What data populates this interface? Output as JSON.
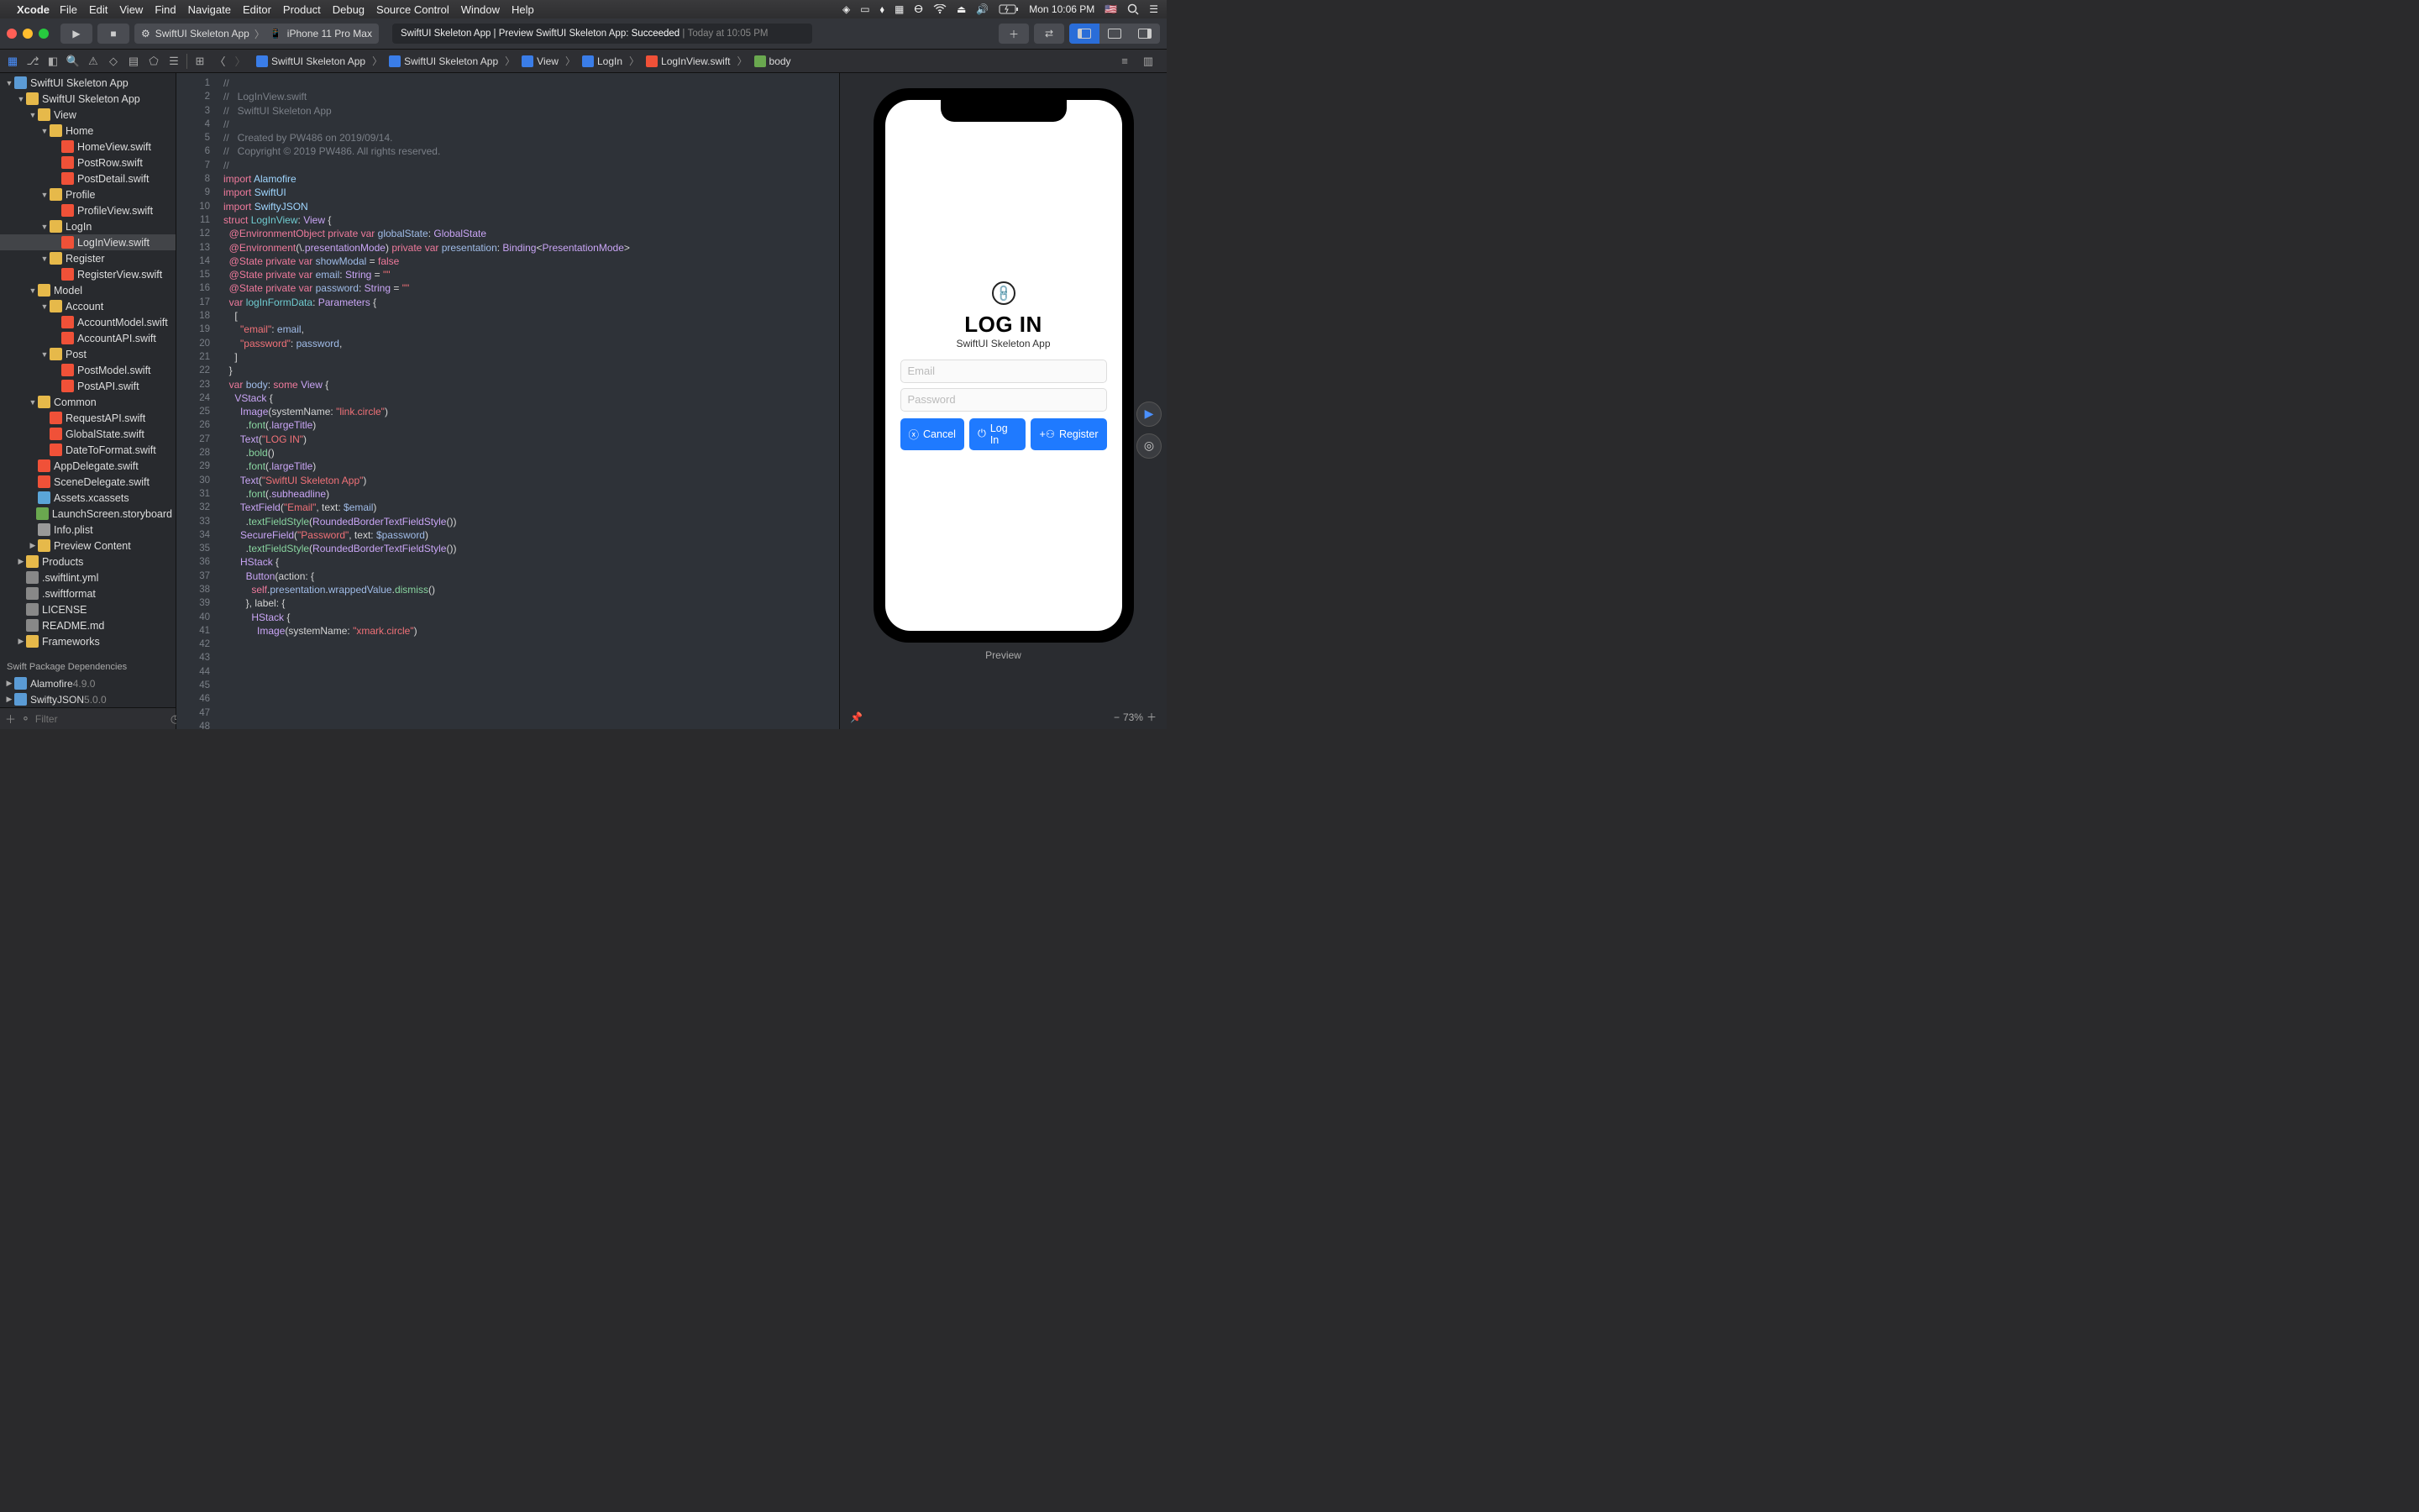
{
  "menubar": {
    "app": "Xcode",
    "items": [
      "File",
      "Edit",
      "View",
      "Find",
      "Navigate",
      "Editor",
      "Product",
      "Debug",
      "Source Control",
      "Window",
      "Help"
    ],
    "time": "Mon 10:06 PM"
  },
  "toolbar": {
    "scheme_app": "SwiftUI Skeleton App",
    "scheme_device": "iPhone 11 Pro Max",
    "activity_target": "SwiftUI Skeleton App | Preview SwiftUI Skeleton App:",
    "activity_status": "Succeeded",
    "activity_time": "Today at 10:05 PM"
  },
  "jumpbar": [
    "SwiftUI Skeleton App",
    "SwiftUI Skeleton App",
    "View",
    "LogIn",
    "LogInView.swift",
    "body"
  ],
  "tree": [
    {
      "d": 0,
      "t": "SwiftUI Skeleton App",
      "i": "proj",
      "e": true
    },
    {
      "d": 1,
      "t": "SwiftUI Skeleton App",
      "i": "folder",
      "e": true,
      "y": true
    },
    {
      "d": 2,
      "t": "View",
      "i": "folder",
      "e": true,
      "y": true
    },
    {
      "d": 3,
      "t": "Home",
      "i": "folder",
      "e": true,
      "y": true
    },
    {
      "d": 4,
      "t": "HomeView.swift",
      "i": "swift"
    },
    {
      "d": 4,
      "t": "PostRow.swift",
      "i": "swift"
    },
    {
      "d": 4,
      "t": "PostDetail.swift",
      "i": "swift"
    },
    {
      "d": 3,
      "t": "Profile",
      "i": "folder",
      "e": true,
      "y": true
    },
    {
      "d": 4,
      "t": "ProfileView.swift",
      "i": "swift"
    },
    {
      "d": 3,
      "t": "LogIn",
      "i": "folder",
      "e": true,
      "y": true
    },
    {
      "d": 4,
      "t": "LogInView.swift",
      "i": "swift",
      "sel": true
    },
    {
      "d": 3,
      "t": "Register",
      "i": "folder",
      "e": true,
      "y": true
    },
    {
      "d": 4,
      "t": "RegisterView.swift",
      "i": "swift"
    },
    {
      "d": 2,
      "t": "Model",
      "i": "folder",
      "e": true,
      "y": true
    },
    {
      "d": 3,
      "t": "Account",
      "i": "folder",
      "e": true,
      "y": true
    },
    {
      "d": 4,
      "t": "AccountModel.swift",
      "i": "swift"
    },
    {
      "d": 4,
      "t": "AccountAPI.swift",
      "i": "swift"
    },
    {
      "d": 3,
      "t": "Post",
      "i": "folder",
      "e": true,
      "y": true
    },
    {
      "d": 4,
      "t": "PostModel.swift",
      "i": "swift"
    },
    {
      "d": 4,
      "t": "PostAPI.swift",
      "i": "swift"
    },
    {
      "d": 2,
      "t": "Common",
      "i": "folder",
      "e": true,
      "y": true
    },
    {
      "d": 3,
      "t": "RequestAPI.swift",
      "i": "swift"
    },
    {
      "d": 3,
      "t": "GlobalState.swift",
      "i": "swift"
    },
    {
      "d": 3,
      "t": "DateToFormat.swift",
      "i": "swift"
    },
    {
      "d": 2,
      "t": "AppDelegate.swift",
      "i": "swift"
    },
    {
      "d": 2,
      "t": "SceneDelegate.swift",
      "i": "swift"
    },
    {
      "d": 2,
      "t": "Assets.xcassets",
      "i": "img"
    },
    {
      "d": 2,
      "t": "LaunchScreen.storyboard",
      "i": "storyboard"
    },
    {
      "d": 2,
      "t": "Info.plist",
      "i": "plist"
    },
    {
      "d": 2,
      "t": "Preview Content",
      "i": "folder",
      "e": false,
      "y": true
    },
    {
      "d": 1,
      "t": "Products",
      "i": "folder",
      "e": false,
      "y": true
    },
    {
      "d": 1,
      "t": ".swiftlint.yml",
      "i": "file"
    },
    {
      "d": 1,
      "t": ".swiftformat",
      "i": "file"
    },
    {
      "d": 1,
      "t": "LICENSE",
      "i": "file"
    },
    {
      "d": 1,
      "t": "README.md",
      "i": "file"
    },
    {
      "d": 1,
      "t": "Frameworks",
      "i": "folder",
      "e": false,
      "y": true
    }
  ],
  "deps_header": "Swift Package Dependencies",
  "deps": [
    {
      "name": "Alamofire",
      "ver": "4.9.0"
    },
    {
      "name": "SwiftyJSON",
      "ver": "5.0.0"
    }
  ],
  "filter_placeholder": "Filter",
  "code_lines": [
    [
      [
        "c-comment",
        "//"
      ]
    ],
    [
      [
        "c-comment",
        "//   LogInView.swift"
      ]
    ],
    [
      [
        "c-comment",
        "//   SwiftUI Skeleton App"
      ]
    ],
    [
      [
        "c-comment",
        "//"
      ]
    ],
    [
      [
        "c-comment",
        "//   Created by PW486 on 2019/09/14."
      ]
    ],
    [
      [
        "c-comment",
        "//   Copyright © 2019 PW486. All rights reserved."
      ]
    ],
    [
      [
        "c-comment",
        "//"
      ]
    ],
    [
      [
        "",
        ""
      ]
    ],
    [
      [
        "c-keyword",
        "import"
      ],
      [
        "",
        " "
      ],
      [
        "c-type",
        "Alamofire"
      ]
    ],
    [
      [
        "c-keyword",
        "import"
      ],
      [
        "",
        " "
      ],
      [
        "c-type",
        "SwiftUI"
      ]
    ],
    [
      [
        "c-keyword",
        "import"
      ],
      [
        "",
        " "
      ],
      [
        "c-type",
        "SwiftyJSON"
      ]
    ],
    [
      [
        "",
        ""
      ]
    ],
    [
      [
        "c-keyword",
        "struct"
      ],
      [
        "",
        " "
      ],
      [
        "c-teal",
        "LogInView"
      ],
      [
        "",
        ": "
      ],
      [
        "c-purple",
        "View"
      ],
      [
        "",
        " {"
      ]
    ],
    [
      [
        "",
        "  "
      ],
      [
        "c-keyword",
        "@EnvironmentObject"
      ],
      [
        "",
        " "
      ],
      [
        "c-keyword",
        "private"
      ],
      [
        "",
        " "
      ],
      [
        "c-keyword",
        "var"
      ],
      [
        "",
        " "
      ],
      [
        "c-prop",
        "globalState"
      ],
      [
        "",
        ": "
      ],
      [
        "c-purple",
        "GlobalState"
      ]
    ],
    [
      [
        "",
        "  "
      ],
      [
        "c-keyword",
        "@Environment"
      ],
      [
        "",
        "(\\."
      ],
      [
        "c-purple",
        "presentationMode"
      ],
      [
        "",
        ") "
      ],
      [
        "c-keyword",
        "private"
      ],
      [
        "",
        " "
      ],
      [
        "c-keyword",
        "var"
      ],
      [
        "",
        " "
      ],
      [
        "c-prop",
        "presentation"
      ],
      [
        "",
        ": "
      ],
      [
        "c-purple",
        "Binding"
      ],
      [
        "",
        "<"
      ],
      [
        "c-purple",
        "PresentationMode"
      ],
      [
        "",
        ">"
      ]
    ],
    [
      [
        "",
        ""
      ]
    ],
    [
      [
        "",
        "  "
      ],
      [
        "c-keyword",
        "@State"
      ],
      [
        "",
        " "
      ],
      [
        "c-keyword",
        "private"
      ],
      [
        "",
        " "
      ],
      [
        "c-keyword",
        "var"
      ],
      [
        "",
        " "
      ],
      [
        "c-prop",
        "showModal"
      ],
      [
        "",
        " = "
      ],
      [
        "c-keyword",
        "false"
      ]
    ],
    [
      [
        "",
        "  "
      ],
      [
        "c-keyword",
        "@State"
      ],
      [
        "",
        " "
      ],
      [
        "c-keyword",
        "private"
      ],
      [
        "",
        " "
      ],
      [
        "c-keyword",
        "var"
      ],
      [
        "",
        " "
      ],
      [
        "c-prop",
        "email"
      ],
      [
        "",
        ": "
      ],
      [
        "c-purple",
        "String"
      ],
      [
        "",
        " = "
      ],
      [
        "c-string",
        "\"\""
      ]
    ],
    [
      [
        "",
        "  "
      ],
      [
        "c-keyword",
        "@State"
      ],
      [
        "",
        " "
      ],
      [
        "c-keyword",
        "private"
      ],
      [
        "",
        " "
      ],
      [
        "c-keyword",
        "var"
      ],
      [
        "",
        " "
      ],
      [
        "c-prop",
        "password"
      ],
      [
        "",
        ": "
      ],
      [
        "c-purple",
        "String"
      ],
      [
        "",
        " = "
      ],
      [
        "c-string",
        "\"\""
      ]
    ],
    [
      [
        "",
        ""
      ]
    ],
    [
      [
        "",
        "  "
      ],
      [
        "c-keyword",
        "var"
      ],
      [
        "",
        " "
      ],
      [
        "c-teal",
        "logInFormData"
      ],
      [
        "",
        ": "
      ],
      [
        "c-purple",
        "Parameters"
      ],
      [
        "",
        " {"
      ]
    ],
    [
      [
        "",
        "    ["
      ]
    ],
    [
      [
        "",
        "      "
      ],
      [
        "c-string",
        "\"email\""
      ],
      [
        "",
        ": "
      ],
      [
        "c-prop",
        "email"
      ],
      [
        "",
        ","
      ]
    ],
    [
      [
        "",
        "      "
      ],
      [
        "c-string",
        "\"password\""
      ],
      [
        "",
        ": "
      ],
      [
        "c-prop",
        "password"
      ],
      [
        "",
        ","
      ]
    ],
    [
      [
        "",
        "    ]"
      ]
    ],
    [
      [
        "",
        "  }"
      ]
    ],
    [
      [
        "",
        ""
      ]
    ],
    [
      [
        "",
        "  "
      ],
      [
        "c-keyword",
        "var"
      ],
      [
        "",
        " "
      ],
      [
        "c-prop",
        "body"
      ],
      [
        "",
        ": "
      ],
      [
        "c-keyword",
        "some"
      ],
      [
        "",
        " "
      ],
      [
        "c-purple",
        "View"
      ],
      [
        "",
        " {"
      ]
    ],
    [
      [
        "",
        "    "
      ],
      [
        "c-purple",
        "VStack"
      ],
      [
        "",
        " {"
      ]
    ],
    [
      [
        "",
        "      "
      ],
      [
        "c-purple",
        "Image"
      ],
      [
        "",
        "(systemName: "
      ],
      [
        "c-string",
        "\"link.circle\""
      ],
      [
        "",
        ")"
      ]
    ],
    [
      [
        "",
        "        ."
      ],
      [
        "c-func",
        "font"
      ],
      [
        "",
        "(."
      ],
      [
        "c-purple",
        "largeTitle"
      ],
      [
        "",
        ")"
      ]
    ],
    [
      [
        "",
        "      "
      ],
      [
        "c-purple",
        "Text"
      ],
      [
        "",
        "("
      ],
      [
        "c-string",
        "\"LOG IN\""
      ],
      [
        "",
        ")"
      ]
    ],
    [
      [
        "",
        "        ."
      ],
      [
        "c-func",
        "bold"
      ],
      [
        "",
        "()"
      ]
    ],
    [
      [
        "",
        "        ."
      ],
      [
        "c-func",
        "font"
      ],
      [
        "",
        "(."
      ],
      [
        "c-purple",
        "largeTitle"
      ],
      [
        "",
        ")"
      ]
    ],
    [
      [
        "",
        "      "
      ],
      [
        "c-purple",
        "Text"
      ],
      [
        "",
        "("
      ],
      [
        "c-string",
        "\"SwiftUI Skeleton App\""
      ],
      [
        "",
        ")"
      ]
    ],
    [
      [
        "",
        "        ."
      ],
      [
        "c-func",
        "font"
      ],
      [
        "",
        "(."
      ],
      [
        "c-purple",
        "subheadline"
      ],
      [
        "",
        ")"
      ]
    ],
    [
      [
        "",
        ""
      ]
    ],
    [
      [
        "",
        "      "
      ],
      [
        "c-purple",
        "TextField"
      ],
      [
        "",
        "("
      ],
      [
        "c-string",
        "\"Email\""
      ],
      [
        "",
        ", text: "
      ],
      [
        "c-prop",
        "$email"
      ],
      [
        "",
        ")"
      ]
    ],
    [
      [
        "",
        "        ."
      ],
      [
        "c-func",
        "textFieldStyle"
      ],
      [
        "",
        "("
      ],
      [
        "c-purple",
        "RoundedBorderTextFieldStyle"
      ],
      [
        "",
        "())"
      ]
    ],
    [
      [
        "",
        "      "
      ],
      [
        "c-purple",
        "SecureField"
      ],
      [
        "",
        "("
      ],
      [
        "c-string",
        "\"Password\""
      ],
      [
        "",
        ", text: "
      ],
      [
        "c-prop",
        "$password"
      ],
      [
        "",
        ")"
      ]
    ],
    [
      [
        "",
        "        ."
      ],
      [
        "c-func",
        "textFieldStyle"
      ],
      [
        "",
        "("
      ],
      [
        "c-purple",
        "RoundedBorderTextFieldStyle"
      ],
      [
        "",
        "())"
      ]
    ],
    [
      [
        "",
        ""
      ]
    ],
    [
      [
        "",
        "      "
      ],
      [
        "c-purple",
        "HStack"
      ],
      [
        "",
        " {"
      ]
    ],
    [
      [
        "",
        "        "
      ],
      [
        "c-purple",
        "Button"
      ],
      [
        "",
        "(action: {"
      ]
    ],
    [
      [
        "",
        "          "
      ],
      [
        "c-keyword",
        "self"
      ],
      [
        "",
        "."
      ],
      [
        "c-prop",
        "presentation"
      ],
      [
        "",
        "."
      ],
      [
        "c-prop",
        "wrappedValue"
      ],
      [
        "",
        "."
      ],
      [
        "c-func",
        "dismiss"
      ],
      [
        "",
        "()"
      ]
    ],
    [
      [
        "",
        "        }, label: {"
      ]
    ],
    [
      [
        "",
        "          "
      ],
      [
        "c-purple",
        "HStack"
      ],
      [
        "",
        " {"
      ]
    ],
    [
      [
        "",
        "            "
      ],
      [
        "c-purple",
        "Image"
      ],
      [
        "",
        "(systemName: "
      ],
      [
        "c-string",
        "\"xmark.circle\""
      ],
      [
        "",
        ")"
      ]
    ]
  ],
  "preview": {
    "title": "LOG IN",
    "subtitle": "SwiftUI Skeleton App",
    "email_ph": "Email",
    "password_ph": "Password",
    "cancel": "Cancel",
    "login": "Log In",
    "register": "Register",
    "label": "Preview",
    "zoom": "73%"
  }
}
